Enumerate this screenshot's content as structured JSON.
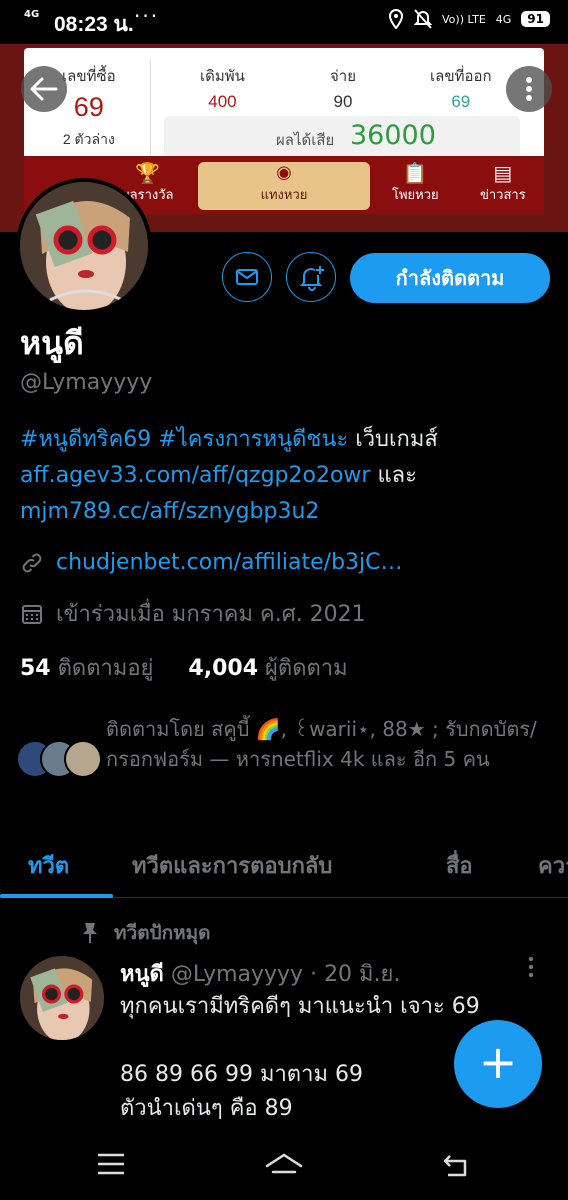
{
  "status_bar": {
    "network": "4G",
    "time": "08:23 น.",
    "more": "···",
    "lte": "Vo)) LTE",
    "signal": "4G",
    "battery": "91"
  },
  "banner": {
    "ticket_label": "เลขที่ซื้อ",
    "ticket_value": "69",
    "ticket_type": "2 ตัวล่าง",
    "bet_label": "เดิมพัน",
    "bet_value": "400",
    "pay_label": "จ่าย",
    "pay_value": "90",
    "result_label": "เลขที่ออก",
    "result_value": "69",
    "profit_label": "ผลได้เสีย",
    "profit_value": "36000",
    "nav": {
      "prize": "ผลรางวัล",
      "bet": "แทงหวย",
      "tips": "โพยหวย",
      "news": "ข่าวสาร"
    }
  },
  "profile": {
    "name": "หนูดี",
    "handle": "@Lymayyyy",
    "bio_hashtag1": "#หนูดีทริค69",
    "bio_hashtag2": "#ไครงการหนูดีชนะ",
    "bio_text1": "เว็บเกมส์",
    "bio_link1": "aff.agev33.com/aff/qzgp2o2owr",
    "bio_text2": "และ",
    "bio_link2": "mjm789.cc/aff/sznygbp3u2",
    "website": "chudjenbet.com/affiliate/b3jC…",
    "joined": "เข้าร่วมเมื่อ มกราคม ค.ศ. 2021",
    "following_count": "54",
    "following_label": "ติดตามอยู่",
    "followers_count": "4,004",
    "followers_label": "ผู้ติดตาม",
    "followed_by": "ติดตามโดย สคูบี้ 🌈, ꒰warii⋆, 88★ ; รับกดบัตร/กรอกฟอร์ม — หารnetflix 4k และ อีก 5 คน",
    "follow_button": "กำลังติดตาม"
  },
  "tabs": [
    "ทวีต",
    "ทวีตและการตอบกลับ",
    "สื่อ",
    "ควา"
  ],
  "tweet": {
    "pinned_label": "ทวีตปักหมุด",
    "author": "หนูดี",
    "handle": "@Lymayyyy",
    "date": "· 20 มิ.ย.",
    "body": "ทุกคนเรามีทริคดีๆ มาแนะนำ เจาะ 69\n\n86 89 66 99  มาตาม 69\nตัวนำเด่นๆ คือ 89"
  },
  "fab_label": "+",
  "colors": {
    "accent": "#1d9bf0",
    "background": "#000000",
    "muted": "#71767b"
  }
}
